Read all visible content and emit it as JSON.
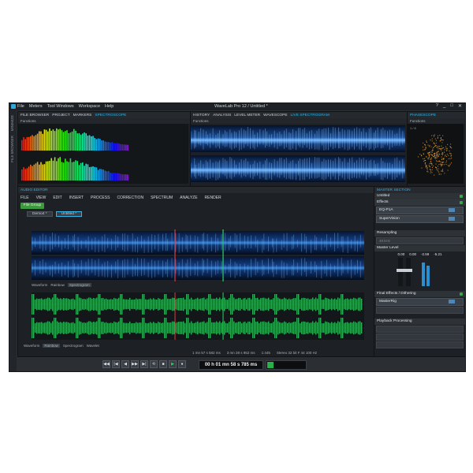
{
  "window": {
    "title": "WaveLab Pro 12 / Untitled *",
    "menu": [
      "File",
      "Meters",
      "Tool Windows",
      "Workspace",
      "Help"
    ],
    "controls": [
      "?",
      "_",
      "□",
      "✕"
    ]
  },
  "left_strip": [
    "MINIMIZE",
    "FILE BROWSER"
  ],
  "panels": {
    "top_left_tabs": [
      "FILE BROWSER",
      "PROJECT",
      "MARKERS",
      "SPECTROSCOPE"
    ],
    "top_left_sub": "Functions",
    "top_mid_tabs": [
      "HISTORY",
      "ANALYSIS",
      "LEVEL METER",
      "WAVESCOPE",
      "LIVE SPECTROGRAM"
    ],
    "top_mid_sub": "Functions",
    "top_right_tabs": [
      "PHASESCOPE"
    ],
    "top_right_sub": "Functions",
    "phasescope_label": "1 / 6"
  },
  "audio_editor": {
    "title": "AUDIO EDITOR",
    "toolbar": [
      "FILE",
      "VIEW",
      "EDIT",
      "INSERT",
      "PROCESS",
      "CORRECTION",
      "SPECTRUM",
      "ANALYZE",
      "RENDER"
    ],
    "active_button": "File Group",
    "file_tabs": [
      "Demo4 *",
      "Untitled *"
    ],
    "top_view_tabs": [
      "Waveform",
      "Rainbow",
      "Spectrogram"
    ],
    "bottom_view_tabs": [
      "Waveform",
      "Rainbow",
      "Spectrogram",
      "Wavelet"
    ],
    "status": {
      "position": "1 mn 57 s 582 ms",
      "range": "3 mn 28 s 952 ms",
      "zoom": "1:445",
      "format": "Stereo 32 bit F 44 100 Hz"
    }
  },
  "master_section": {
    "title": "MASTER SECTION",
    "preset": "Untitled",
    "effects_label": "Effects",
    "plugins": [
      "EQ-P1A",
      "SuperVision"
    ],
    "resampling_label": "Resampling",
    "resampling_value": "48 kHz",
    "master_level_label": "Master Level",
    "levels": [
      "0.00",
      "0.00",
      "-2.59",
      "-5.21"
    ],
    "final_effects_label": "Final Effects / Dithering",
    "final_plugin": "MasterRig",
    "playback_label": "Playback Processing"
  },
  "transport": {
    "buttons": [
      "◀◀",
      "|◀",
      "◀",
      "▶▶",
      "▶|",
      "⟲",
      "■",
      "▶",
      "●"
    ],
    "timecode": "00 h 01 mn 58 s 785 ms"
  },
  "colors": {
    "accent": "#2fb4ec",
    "green": "#3aa84a",
    "playhead": "#2bd463",
    "marker": "#e0393e"
  }
}
